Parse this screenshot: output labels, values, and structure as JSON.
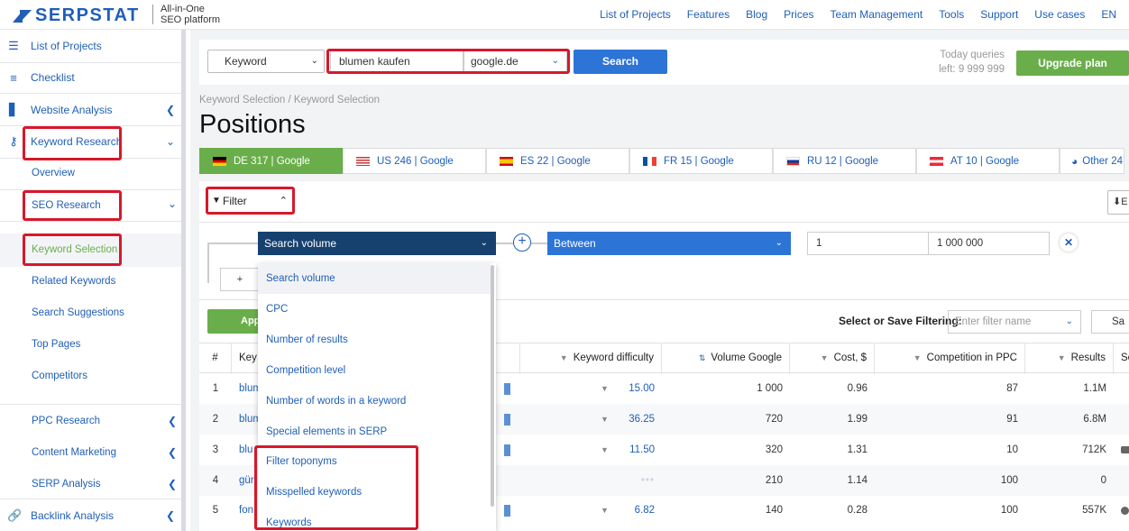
{
  "brand": {
    "name": "SERPSTAT",
    "tagline_1": "All-in-One",
    "tagline_2": "SEO platform"
  },
  "topnav": [
    "List of Projects",
    "Features",
    "Blog",
    "Prices",
    "Team Management",
    "Tools",
    "Support",
    "Use cases",
    "EN"
  ],
  "sidebar": {
    "items": [
      {
        "label": "List of Projects",
        "icon": "list-icon"
      },
      {
        "label": "Checklist",
        "icon": "checklist-icon"
      },
      {
        "label": "Website Analysis",
        "icon": "chart-icon"
      },
      {
        "label": "Keyword Research",
        "icon": "key-icon"
      }
    ],
    "keyword_sub": [
      "Overview",
      "SEO Research",
      "Keyword Selection",
      "Related Keywords",
      "Search Suggestions",
      "Top Pages",
      "Competitors"
    ],
    "lower": [
      "PPC Research",
      "Content Marketing",
      "SERP Analysis",
      "Backlink Analysis"
    ]
  },
  "search": {
    "type_label": "Keyword",
    "query": "blumen kaufen",
    "database": "google.de",
    "button": "Search",
    "quota_line1": "Today queries",
    "quota_line2": "left: 9 999 999",
    "upgrade": "Upgrade plan"
  },
  "breadcrumb": "Keyword Selection / Keyword Selection",
  "page_title": "Positions",
  "db_tabs": [
    {
      "label": "DE 317 | Google",
      "flag": "de"
    },
    {
      "label": "US 246 | Google",
      "flag": "us"
    },
    {
      "label": "ES 22 | Google",
      "flag": "es"
    },
    {
      "label": "FR 15 | Google",
      "flag": "fr"
    },
    {
      "label": "RU 12 | Google",
      "flag": "ru"
    },
    {
      "label": "AT 10 | Google",
      "flag": "at"
    },
    {
      "label": "Other 24",
      "flag": "globe"
    }
  ],
  "filter": {
    "button": "Filter",
    "export_label": "E",
    "field": "Search volume",
    "operator": "Between",
    "from": "1",
    "to": "1 000 000",
    "add_label": "+",
    "apply": "App",
    "select_save_label": "Select or Save Filtering:",
    "filter_name_placeholder": "Enter filter name",
    "save_label": "Sa"
  },
  "dropdown_options": [
    "Search volume",
    "CPC",
    "Number of results",
    "Competition level",
    "Number of words in a keyword",
    "Special elements in SERP",
    "Filter toponyms",
    "Misspelled keywords",
    "Keywords"
  ],
  "table": {
    "headers": [
      "#",
      "Key",
      "Keyword difficulty",
      "Volume Google",
      "Cost, $",
      "Competition in PPC",
      "Results",
      "Soc"
    ],
    "rows": [
      {
        "n": "1",
        "kw": "blum",
        "kd": "15.00",
        "vol": "1 000",
        "cost": "0.96",
        "comp": "87",
        "res": "1.1M"
      },
      {
        "n": "2",
        "kw": "blum",
        "kd": "36.25",
        "vol": "720",
        "cost": "1.99",
        "comp": "91",
        "res": "6.8M"
      },
      {
        "n": "3",
        "kw": "blu",
        "kd": "11.50",
        "vol": "320",
        "cost": "1.31",
        "comp": "10",
        "res": "712K"
      },
      {
        "n": "4",
        "kw": "gür",
        "kd": "•••",
        "vol": "210",
        "cost": "1.14",
        "comp": "100",
        "res": "0"
      },
      {
        "n": "5",
        "kw": "fon",
        "kd": "6.82",
        "vol": "140",
        "cost": "0.28",
        "comp": "100",
        "res": "557K"
      }
    ]
  },
  "colors": {
    "brand_blue": "#1f5fb6",
    "green": "#6aae4b",
    "dark_navy": "#16416f",
    "highlight_red": "#d7182a"
  }
}
